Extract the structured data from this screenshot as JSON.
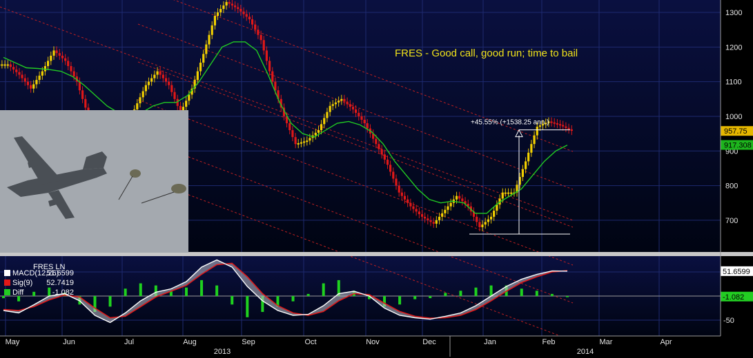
{
  "chart_data": [
    {
      "type": "candlestick",
      "title": "FRES - Good call, good run; time to bail",
      "ylim": [
        610,
        1340
      ],
      "y_ticks": [
        700,
        800,
        900,
        1000,
        1100,
        1200,
        1300
      ],
      "price_tags": [
        {
          "label": "957.75",
          "value": 957.75,
          "color": "#e6b800"
        },
        {
          "label": "917.308",
          "value": 917.308,
          "color": "#1db51d"
        }
      ],
      "annotation": {
        "label": "+45.55% (+1538.25 ann.)",
        "from": 660,
        "to": 960.8
      },
      "series": [
        {
          "name": "price",
          "values": [
            1150,
            1120,
            1080,
            1130,
            1190,
            1160,
            1100,
            1000,
            950,
            930,
            960,
            1020,
            1090,
            1130,
            1090,
            1010,
            1080,
            1180,
            1290,
            1330,
            1310,
            1280,
            1220,
            1100,
            1000,
            920,
            930,
            960,
            1030,
            1050,
            1020,
            980,
            920,
            860,
            780,
            740,
            710,
            690,
            730,
            770,
            740,
            680,
            710,
            780,
            780,
            870,
            970,
            985,
            975,
            958
          ]
        },
        {
          "name": "moving average",
          "values": [
            1170,
            1155,
            1140,
            1138,
            1135,
            1130,
            1115,
            1090,
            1060,
            1030,
            1010,
            1000,
            1010,
            1030,
            1040,
            1040,
            1060,
            1100,
            1150,
            1200,
            1215,
            1215,
            1190,
            1120,
            1040,
            980,
            950,
            940,
            960,
            980,
            985,
            975,
            955,
            920,
            870,
            830,
            790,
            760,
            750,
            755,
            750,
            720,
            720,
            750,
            770,
            790,
            830,
            870,
            900,
            917
          ]
        }
      ]
    },
    {
      "type": "line",
      "panel_title": "FRES LN",
      "ylim": [
        -70,
        85
      ],
      "y_ticks": [
        -50,
        0,
        50
      ],
      "legend": [
        {
          "label": "MACD(12,26)",
          "value": "51.6599",
          "color": "#ffffff"
        },
        {
          "label": "Sig(9)",
          "value": "52.7419",
          "color": "#e01818"
        },
        {
          "label": "Diff",
          "value": "-1.082",
          "color": "#22cc22"
        }
      ],
      "value_tags": [
        {
          "label": "51.6599",
          "value": 51.6599,
          "color": "#ffffff"
        },
        {
          "label": "-1.082",
          "value": -1.082,
          "color": "#22cc22"
        }
      ],
      "series": [
        {
          "name": "MACD(12,26)",
          "values": [
            -30,
            -35,
            -18,
            0,
            5,
            -10,
            -40,
            -55,
            -35,
            -10,
            8,
            15,
            30,
            60,
            75,
            60,
            20,
            -10,
            -30,
            -40,
            -38,
            -20,
            5,
            10,
            0,
            -25,
            -40,
            -45,
            -48,
            -42,
            -35,
            -20,
            0,
            20,
            35,
            45,
            52,
            51.66
          ]
        },
        {
          "name": "Sig(9)",
          "values": [
            -28,
            -30,
            -22,
            -8,
            2,
            -2,
            -25,
            -45,
            -42,
            -22,
            -2,
            10,
            22,
            45,
            65,
            68,
            40,
            5,
            -20,
            -35,
            -40,
            -32,
            -10,
            5,
            3,
            -15,
            -32,
            -42,
            -46,
            -45,
            -40,
            -28,
            -10,
            10,
            28,
            40,
            50,
            52.74
          ]
        }
      ]
    }
  ],
  "x_axis": {
    "months": [
      "May",
      "Jun",
      "Jul",
      "Aug",
      "Sep",
      "Oct",
      "Nov",
      "Dec",
      "Jan",
      "Feb",
      "Mar",
      "Apr"
    ],
    "years": [
      "2013",
      "2014"
    ]
  }
}
